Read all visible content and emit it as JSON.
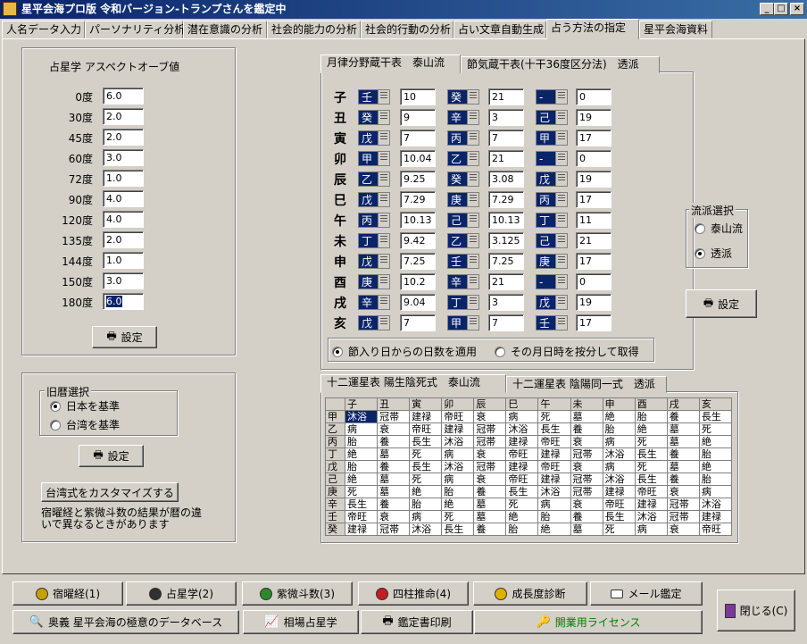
{
  "window": {
    "title": "星平会海プロ版 令和バージョン-トランプさんを鑑定中"
  },
  "tabs": [
    "人名データ入力",
    "パーソナリティ分析",
    "潜在意識の分析",
    "社会的能力の分析",
    "社会的行動の分析",
    "占い文章自動生成",
    "占う方法の指定",
    "星平会海資料"
  ],
  "aspect": {
    "title": "占星学 アスペクトオーブ値",
    "rows": [
      {
        "label": "0度",
        "value": "6.0"
      },
      {
        "label": "30度",
        "value": "2.0"
      },
      {
        "label": "45度",
        "value": "2.0"
      },
      {
        "label": "60度",
        "value": "3.0"
      },
      {
        "label": "72度",
        "value": "1.0"
      },
      {
        "label": "90度",
        "value": "4.0"
      },
      {
        "label": "120度",
        "value": "4.0"
      },
      {
        "label": "135度",
        "value": "2.0"
      },
      {
        "label": "144度",
        "value": "1.0"
      },
      {
        "label": "150度",
        "value": "3.0"
      },
      {
        "label": "180度",
        "value": "6.0"
      }
    ],
    "set_label": "設定"
  },
  "calendar": {
    "title": "旧暦選択",
    "options": [
      "日本を基準",
      "台湾を基準"
    ],
    "set_label": "設定",
    "customize_label": "台湾式をカスタマイズする",
    "note": "宿曜経と紫微斗数の結果が暦の違いで異なるときがあります"
  },
  "zokan": {
    "tabs": [
      "月律分野蔵干表　泰山流",
      "節気蔵干表(十干36度区分法)　透派"
    ],
    "rows": [
      {
        "z": "子",
        "a": "壬",
        "av": "10",
        "b": "癸",
        "bv": "21",
        "c": "-",
        "cv": "0"
      },
      {
        "z": "丑",
        "a": "癸",
        "av": "9",
        "b": "辛",
        "bv": "3",
        "c": "己",
        "cv": "19"
      },
      {
        "z": "寅",
        "a": "戊",
        "av": "7",
        "b": "丙",
        "bv": "7",
        "c": "甲",
        "cv": "17"
      },
      {
        "z": "卯",
        "a": "甲",
        "av": "10.04",
        "b": "乙",
        "bv": "21",
        "c": "-",
        "cv": "0"
      },
      {
        "z": "辰",
        "a": "乙",
        "av": "9.25",
        "b": "癸",
        "bv": "3.08",
        "c": "戊",
        "cv": "19"
      },
      {
        "z": "巳",
        "a": "戊",
        "av": "7.29",
        "b": "庚",
        "bv": "7.29",
        "c": "丙",
        "cv": "17"
      },
      {
        "z": "午",
        "a": "丙",
        "av": "10.13",
        "b": "己",
        "bv": "10.13",
        "c": "丁",
        "cv": "11"
      },
      {
        "z": "未",
        "a": "丁",
        "av": "9.42",
        "b": "乙",
        "bv": "3.125",
        "c": "己",
        "cv": "21"
      },
      {
        "z": "申",
        "a": "戊",
        "av": "7.25",
        "b": "壬",
        "bv": "7.25",
        "c": "庚",
        "cv": "17"
      },
      {
        "z": "酉",
        "a": "庚",
        "av": "10.2",
        "b": "辛",
        "bv": "21",
        "c": "-",
        "cv": "0"
      },
      {
        "z": "戌",
        "a": "辛",
        "av": "9.04",
        "b": "丁",
        "bv": "3",
        "c": "戊",
        "cv": "19"
      },
      {
        "z": "亥",
        "a": "戊",
        "av": "7",
        "b": "甲",
        "bv": "7",
        "c": "壬",
        "cv": "17"
      }
    ],
    "options": [
      "節入り日からの日数を適用",
      "その月日時を按分して取得"
    ]
  },
  "school": {
    "title": "流派選択",
    "options": [
      "泰山流",
      "透派"
    ],
    "set_label": "設定"
  },
  "unsei": {
    "tabs": [
      "十二運星表 陽生陰死式　泰山流",
      "十二運星表 陰陽同一式　透派"
    ],
    "header": [
      "子",
      "丑",
      "寅",
      "卯",
      "辰",
      "巳",
      "午",
      "未",
      "申",
      "酉",
      "戌",
      "亥"
    ],
    "rows": [
      {
        "k": "甲",
        "v": [
          "沐浴",
          "冠帯",
          "建禄",
          "帝旺",
          "衰",
          "病",
          "死",
          "墓",
          "絶",
          "胎",
          "養",
          "長生"
        ]
      },
      {
        "k": "乙",
        "v": [
          "病",
          "衰",
          "帝旺",
          "建禄",
          "冠帯",
          "沐浴",
          "長生",
          "養",
          "胎",
          "絶",
          "墓",
          "死"
        ]
      },
      {
        "k": "丙",
        "v": [
          "胎",
          "養",
          "長生",
          "沐浴",
          "冠帯",
          "建禄",
          "帝旺",
          "衰",
          "病",
          "死",
          "墓",
          "絶"
        ]
      },
      {
        "k": "丁",
        "v": [
          "絶",
          "墓",
          "死",
          "病",
          "衰",
          "帝旺",
          "建禄",
          "冠帯",
          "沐浴",
          "長生",
          "養",
          "胎"
        ]
      },
      {
        "k": "戊",
        "v": [
          "胎",
          "養",
          "長生",
          "沐浴",
          "冠帯",
          "建禄",
          "帝旺",
          "衰",
          "病",
          "死",
          "墓",
          "絶"
        ]
      },
      {
        "k": "己",
        "v": [
          "絶",
          "墓",
          "死",
          "病",
          "衰",
          "帝旺",
          "建禄",
          "冠帯",
          "沐浴",
          "長生",
          "養",
          "胎"
        ]
      },
      {
        "k": "庚",
        "v": [
          "死",
          "墓",
          "絶",
          "胎",
          "養",
          "長生",
          "沐浴",
          "冠帯",
          "建禄",
          "帝旺",
          "衰",
          "病"
        ]
      },
      {
        "k": "辛",
        "v": [
          "長生",
          "養",
          "胎",
          "絶",
          "墓",
          "死",
          "病",
          "衰",
          "帝旺",
          "建禄",
          "冠帯",
          "沐浴"
        ]
      },
      {
        "k": "壬",
        "v": [
          "帝旺",
          "衰",
          "病",
          "死",
          "墓",
          "絶",
          "胎",
          "養",
          "長生",
          "沐浴",
          "冠帯",
          "建禄"
        ]
      },
      {
        "k": "癸",
        "v": [
          "建禄",
          "冠帯",
          "沐浴",
          "長生",
          "養",
          "胎",
          "絶",
          "墓",
          "死",
          "病",
          "衰",
          "帝旺"
        ]
      }
    ]
  },
  "bottom": {
    "row1": [
      "宿曜経(1)",
      "占星学(2)",
      "紫微斗数(3)",
      "四柱推命(4)",
      "成長度診断",
      "メール鑑定"
    ],
    "row2": [
      "奥義 星平会海の極意のデータベース",
      "相場占星学",
      "鑑定書印刷",
      "開業用ライセンス"
    ],
    "close": "閉じる(C)"
  },
  "colors": {
    "title_bar": "#0a246a",
    "selection": "#0a246a",
    "license_text": "#008000"
  }
}
